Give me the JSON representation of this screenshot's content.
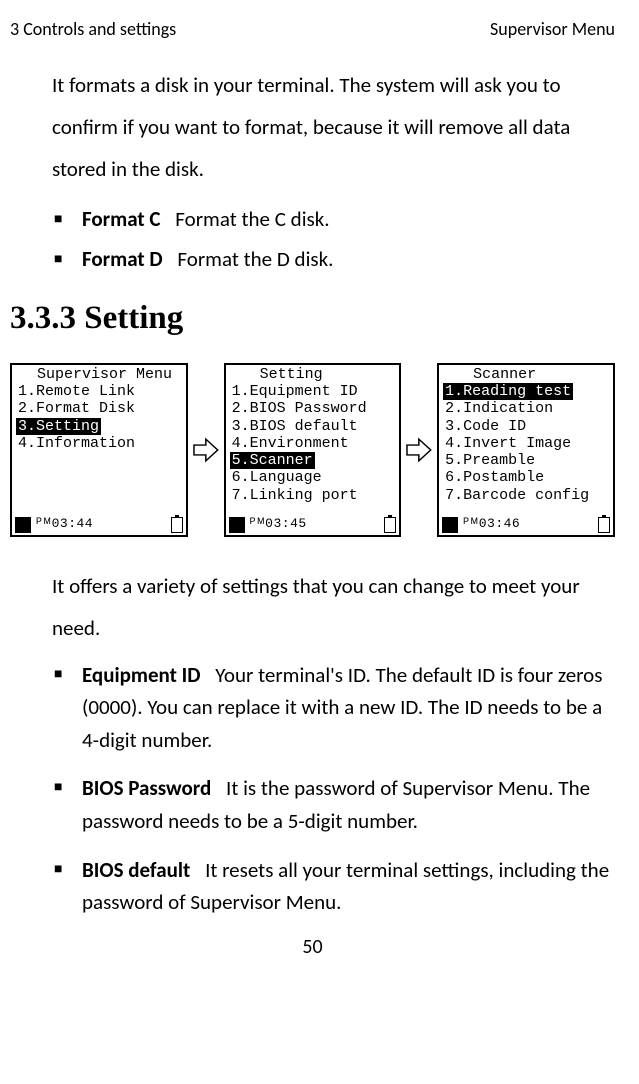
{
  "header": {
    "left": "3 Controls and settings",
    "right": "Supervisor Menu"
  },
  "intro": "It formats a disk in your terminal. The system will ask you to confirm if you want to format, because it will remove all data stored in the disk.",
  "format_items": [
    {
      "term": "Format C",
      "detail": "Format the C disk."
    },
    {
      "term": "Format D",
      "detail": " Format the D disk."
    }
  ],
  "section_heading": "3.3.3  Setting",
  "screens": [
    {
      "title": " Supervisor Menu",
      "items": [
        {
          "text": "1.Remote Link",
          "selected": false
        },
        {
          "text": "2.Format Disk",
          "selected": false
        },
        {
          "text": "3.Setting",
          "selected": true
        },
        {
          "text": "4.Information",
          "selected": false
        }
      ],
      "time": "ᴾᴹ03:44"
    },
    {
      "title": "  Setting",
      "items": [
        {
          "text": "1.Equipment ID",
          "selected": false
        },
        {
          "text": "2.BIOS Password",
          "selected": false
        },
        {
          "text": "3.BIOS default",
          "selected": false
        },
        {
          "text": "4.Environment",
          "selected": false
        },
        {
          "text": "5.Scanner",
          "selected": true
        },
        {
          "text": "6.Language",
          "selected": false
        },
        {
          "text": "7.Linking port",
          "selected": false
        }
      ],
      "time": "ᴾᴹ03:45"
    },
    {
      "title": "  Scanner",
      "items": [
        {
          "text": "1.Reading test",
          "selected": true
        },
        {
          "text": "2.Indication",
          "selected": false
        },
        {
          "text": "3.Code ID",
          "selected": false
        },
        {
          "text": "4.Invert Image",
          "selected": false
        },
        {
          "text": "5.Preamble",
          "selected": false
        },
        {
          "text": "6.Postamble",
          "selected": false
        },
        {
          "text": "7.Barcode config",
          "selected": false
        }
      ],
      "time": "ᴾᴹ03:46"
    }
  ],
  "after_desc": "It offers a variety of settings that you can change to meet your need.",
  "setting_items": [
    {
      "term": "Equipment ID",
      "detail": "Your terminal's ID. The default ID is four zeros (0000). You can replace it with a new ID. The ID needs to be a 4-digit number."
    },
    {
      "term": "BIOS Password",
      "detail": "It is the password of Supervisor Menu. The password needs to be a 5-digit number."
    },
    {
      "term": "BIOS default",
      "detail": "It resets all your terminal settings, including the password of Supervisor Menu."
    }
  ],
  "page_number": "50"
}
